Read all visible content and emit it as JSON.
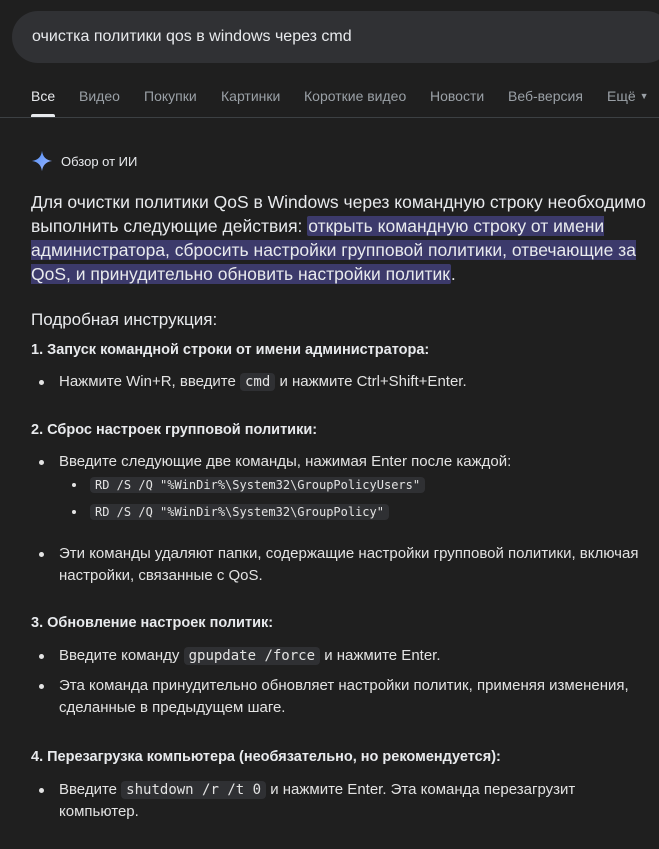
{
  "search": {
    "query": "очистка политики qos в windows через cmd"
  },
  "tabs": [
    {
      "label": "Все"
    },
    {
      "label": "Видео"
    },
    {
      "label": "Покупки"
    },
    {
      "label": "Картинки"
    },
    {
      "label": "Короткие видео"
    },
    {
      "label": "Новости"
    },
    {
      "label": "Веб-версия"
    },
    {
      "label": "Ещё"
    }
  ],
  "ai_overview": {
    "header": "Обзор от ИИ",
    "intro_plain": "Для очистки политики QoS в Windows через командную строку необходимо выполнить следующие действия: ",
    "intro_highlight": "открыть командную строку от имени администратора, сбросить настройки групповой политики, отвечающие за QoS, и принудительно обновить настройки политик",
    "intro_end": ".",
    "subhead": "Подробная инструкция:",
    "steps": [
      {
        "title": "1. Запуск командной строки от имени администратора:",
        "b1_pre": "Нажмите Win+R, введите ",
        "b1_code": "cmd",
        "b1_post": " и нажмите Ctrl+Shift+Enter."
      },
      {
        "title": "2. Сброс настроек групповой политики:",
        "b1": "Введите следующие две команды, нажимая Enter после каждой:",
        "sub1": "RD /S /Q \"%WinDir%\\System32\\GroupPolicyUsers\"",
        "sub2": "RD /S /Q \"%WinDir%\\System32\\GroupPolicy\"",
        "b2": "Эти команды удаляют папки, содержащие настройки групповой политики, включая настройки, связанные с QoS."
      },
      {
        "title": "3. Обновление настроек политик:",
        "b1_pre": "Введите команду ",
        "b1_code": "gpupdate /force",
        "b1_post": " и нажмите Enter.",
        "b2": "Эта команда принудительно обновляет настройки политик, применяя изменения, сделанные в предыдущем шаге."
      },
      {
        "title": "4. Перезагрузка компьютера (необязательно, но рекомендуется):",
        "b1_pre": "Введите ",
        "b1_code": "shutdown /r /t 0",
        "b1_post": " и нажмите Enter. Эта команда перезагрузит компьютер."
      }
    ]
  }
}
